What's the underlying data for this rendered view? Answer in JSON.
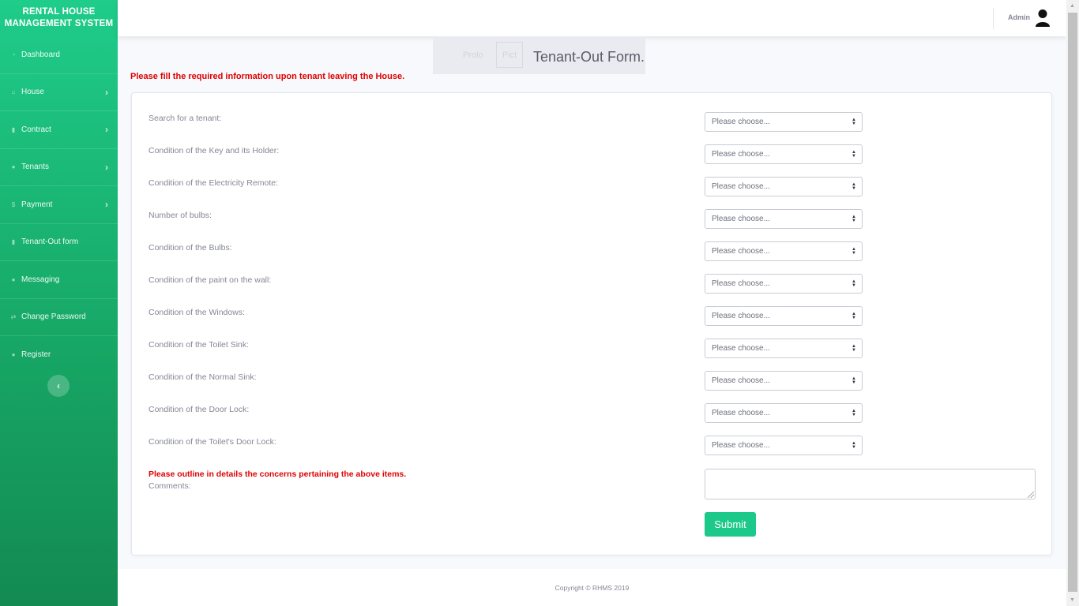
{
  "brand": "RENTAL HOUSE MANAGEMENT SYSTEM",
  "sidebar": {
    "items": [
      {
        "label": "Dashboard",
        "icon": "dashboard-icon",
        "has_chevron": false
      },
      {
        "label": "House",
        "icon": "home-icon",
        "has_chevron": true
      },
      {
        "label": "Contract",
        "icon": "file-icon",
        "has_chevron": true
      },
      {
        "label": "Tenants",
        "icon": "user-icon",
        "has_chevron": true
      },
      {
        "label": "Payment",
        "icon": "dollar-icon",
        "has_chevron": true
      },
      {
        "label": "Tenant-Out form",
        "icon": "trash-icon",
        "has_chevron": false
      },
      {
        "label": "Messaging",
        "icon": "comments-icon",
        "has_chevron": false
      },
      {
        "label": "Change Password",
        "icon": "exchange-icon",
        "has_chevron": false
      },
      {
        "label": "Register",
        "icon": "user-icon",
        "has_chevron": false
      }
    ]
  },
  "topbar": {
    "user": "Admin"
  },
  "header": {
    "title": "Tenant-Out Form.",
    "ghost_left": "Prolo",
    "ghost_box": "Pict"
  },
  "notice": "Please fill the required information upon tenant leaving the House.",
  "form": {
    "select_placeholder": "Please choose...",
    "fields": [
      "Search for a tenant:",
      "Condition of the Key and its Holder:",
      "Condition of the Electricity Remote:",
      "Number of bulbs:",
      "Condition of the Bulbs:",
      "Condition of the paint on the wall:",
      "Condition of the Windows:",
      "Condition of the Toilet Sink:",
      "Condition of the Normal Sink:",
      "Condition of the Door Lock:",
      "Condition of the Toilet's Door Lock:"
    ],
    "concern_text": "Please outline in details the concerns pertaining the above items.",
    "comments_label": "Comments:",
    "submit_label": "Submit"
  },
  "footer": "Copyright © RHMS 2019",
  "colors": {
    "accent": "#1cc88a",
    "alert": "#e00000",
    "muted": "#858796"
  }
}
